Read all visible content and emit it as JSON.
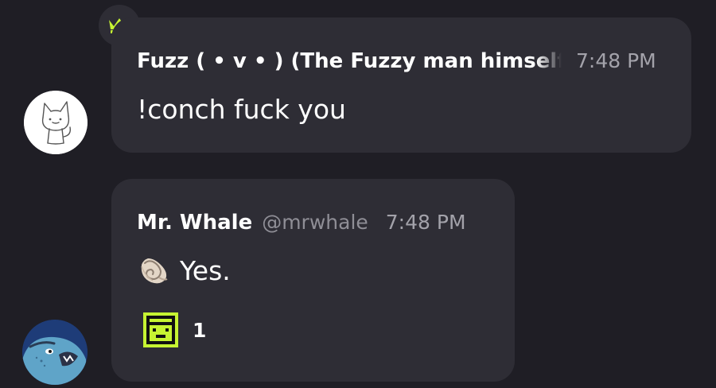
{
  "messages": [
    {
      "author": "Fuzz ( • v • ) (The Fuzzy man himself)",
      "time": "7:48 PM",
      "text": "!conch fuck you",
      "avatar_icon": "white-cat-avatar",
      "badge_icon": "crown-icon",
      "badge_color": "#c6f432"
    },
    {
      "author": "Mr. Whale",
      "handle": "@mrwhale",
      "time": "7:48 PM",
      "emoji_icon": "spiral-shell-icon",
      "text": "Yes.",
      "avatar_icon": "angry-whale-avatar",
      "reaction": {
        "icon": "green-pixel-face-icon",
        "count": "1",
        "color": "#c6f432"
      }
    }
  ],
  "colors": {
    "background": "#1f1e25",
    "bubble": "#2e2d35",
    "muted_text": "#a3a2aa",
    "accent": "#c6f432"
  }
}
